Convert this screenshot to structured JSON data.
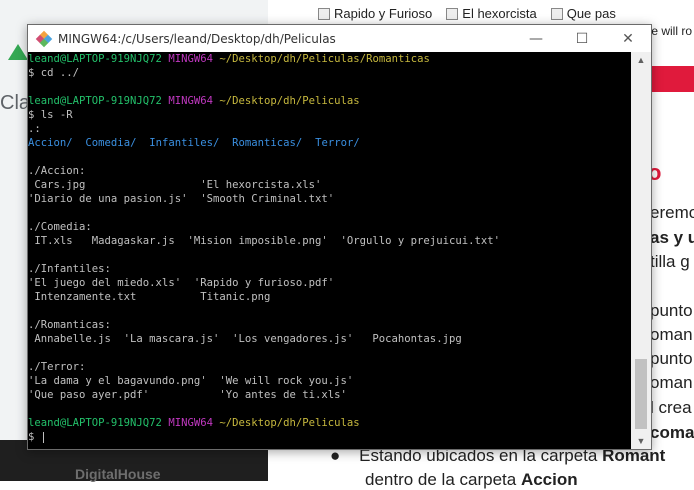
{
  "background": {
    "files": [
      "Rapido y Furioso",
      "El hexorcista",
      "Que pas"
    ],
    "file_partial": "/e will ro",
    "left_heading": "Cla",
    "logo_text": "DigitalHouse",
    "red_letter": "o",
    "doc_lines": [
      "eremo",
      "as y u",
      "tilla g",
      "punto",
      "oman",
      "punto",
      "oman",
      "l crea",
      "coma"
    ],
    "bullet_prefix": "Estando ubicados en la carpeta ",
    "bullet_bold": "Romant",
    "bullet2_prefix": "dentro de la carpeta ",
    "bullet2_bold": "Accion"
  },
  "window": {
    "title": "MINGW64:/c/Users/leand/Desktop/dh/Peliculas",
    "min_glyph": "—",
    "max_glyph": "☐",
    "close_glyph": "✕"
  },
  "terminal": {
    "prompt1": {
      "user": "leand@LAPTOP-919NJQ72",
      "sys": "MINGW64",
      "path": "~/Desktop/dh/Peliculas/Romanticas"
    },
    "cmd1": "$ cd ../",
    "prompt2": {
      "user": "leand@LAPTOP-919NJQ72",
      "sys": "MINGW64",
      "path": "~/Desktop/dh/Peliculas"
    },
    "cmd2": "$ ls -R",
    "root_label": ".:",
    "dirs": [
      "Accion/",
      "Comedia/",
      "Infantiles/",
      "Romanticas/",
      "Terror/"
    ],
    "sections": [
      {
        "header": "./Accion:",
        "lines": [
          " Cars.jpg                  'El hexorcista.xls'",
          "'Diario de una pasion.js'  'Smooth Criminal.txt'"
        ]
      },
      {
        "header": "./Comedia:",
        "lines": [
          " IT.xls   Madagaskar.js  'Mision imposible.png'  'Orgullo y prejuicui.txt'"
        ]
      },
      {
        "header": "./Infantiles:",
        "lines": [
          "'El juego del miedo.xls'  'Rapido y furioso.pdf'",
          " Intenzamente.txt          Titanic.png"
        ]
      },
      {
        "header": "./Romanticas:",
        "lines": [
          " Annabelle.js  'La mascara.js'  'Los vengadores.js'   Pocahontas.jpg"
        ]
      },
      {
        "header": "./Terror:",
        "lines": [
          "'La dama y el bagavundo.png'  'We will rock you.js'",
          "'Que paso ayer.pdf'           'Yo antes de ti.xls'"
        ]
      }
    ],
    "prompt3": {
      "user": "leand@LAPTOP-919NJQ72",
      "sys": "MINGW64",
      "path": "~/Desktop/dh/Peliculas"
    },
    "cmd3": "$ "
  },
  "colors": {
    "user": "#23c06a",
    "system": "#c038c0",
    "path": "#c6b83e",
    "directory": "#3a8fe0"
  }
}
